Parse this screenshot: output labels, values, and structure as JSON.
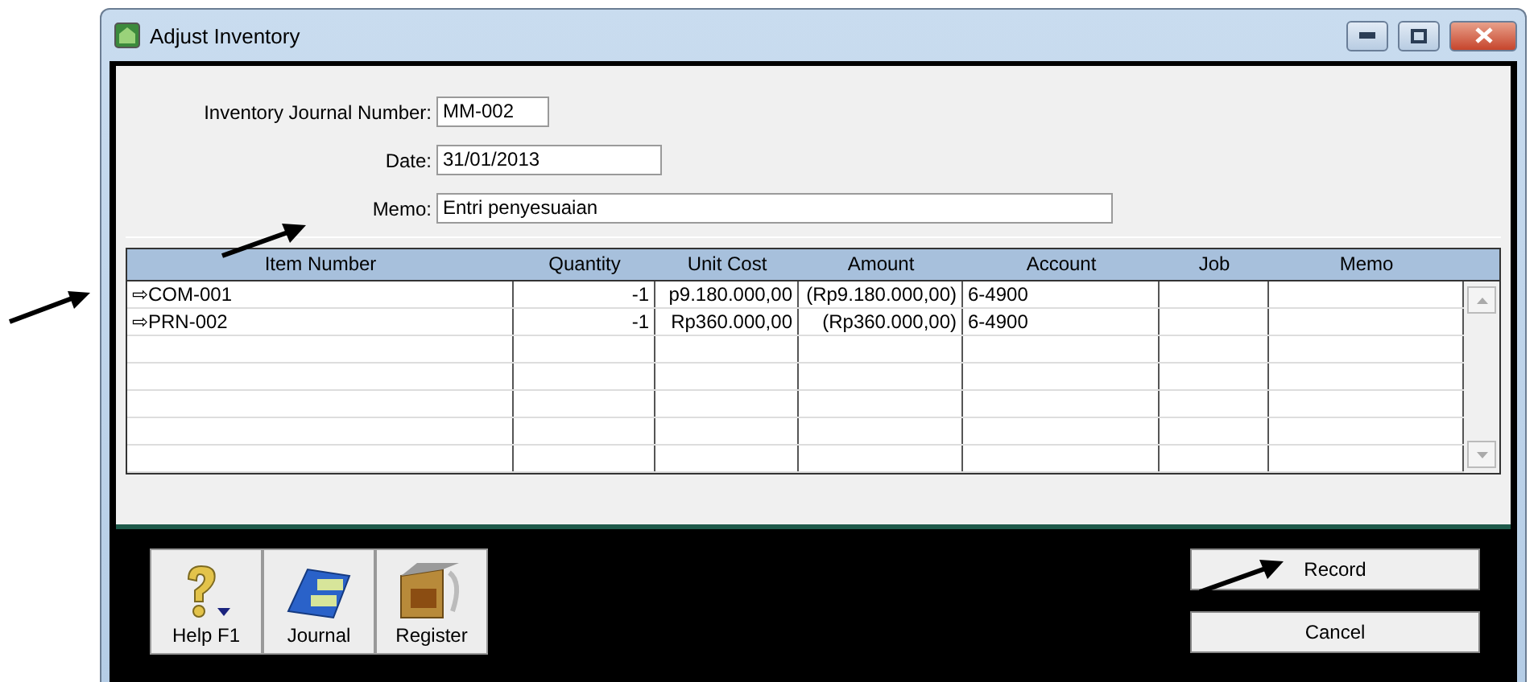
{
  "window": {
    "title": "Adjust Inventory"
  },
  "form": [
    {
      "label": "Inventory Journal Number:",
      "value": "MM-002"
    },
    {
      "label": "Date:",
      "value": "31/01/2013"
    },
    {
      "label": "Memo:",
      "value": "Entri penyesuaian"
    }
  ],
  "table": {
    "columns": [
      "Item Number",
      "Quantity",
      "Unit Cost",
      "Amount",
      "Account",
      "Job",
      "Memo"
    ],
    "rows": [
      {
        "item_number": "⇨COM-001",
        "quantity": "-1",
        "unit_cost": "p9.180.000,00",
        "amount": "(Rp9.180.000,00)",
        "account": "6-4900"
      },
      {
        "item_number": "⇨PRN-002",
        "quantity": "-1",
        "unit_cost": "Rp360.000,00",
        "amount": "(Rp360.000,00)",
        "account": "6-4900"
      }
    ]
  },
  "toolbar": [
    {
      "kind": "help",
      "label": "Help F1"
    },
    {
      "kind": "journal",
      "label": "Journal"
    },
    {
      "kind": "register",
      "label": "Register"
    }
  ],
  "actions": [
    "Record",
    "Cancel"
  ]
}
